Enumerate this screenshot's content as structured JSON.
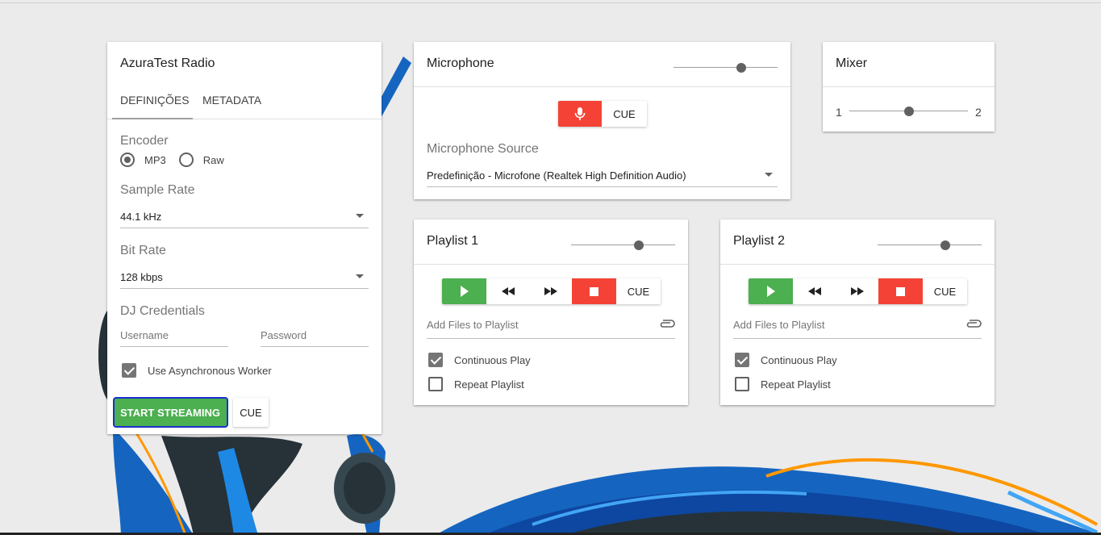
{
  "settings": {
    "title": "AzuraTest Radio",
    "tabs": [
      "DEFINIÇÕES",
      "METADATA"
    ],
    "encoder": {
      "label": "Encoder",
      "options": [
        "MP3",
        "Raw"
      ],
      "selected": "MP3"
    },
    "sample_rate": {
      "label": "Sample Rate",
      "value": "44.1 kHz"
    },
    "bit_rate": {
      "label": "Bit Rate",
      "value": "128 kbps"
    },
    "credentials": {
      "label": "DJ Credentials",
      "username_placeholder": "Username",
      "password_placeholder": "Password"
    },
    "async_worker": {
      "label": "Use Asynchronous Worker",
      "checked": true
    },
    "start_label": "START STREAMING",
    "cue_label": "CUE"
  },
  "microphone": {
    "title": "Microphone",
    "volume": 0.65,
    "cue_label": "CUE",
    "source_label": "Microphone Source",
    "source_value": "Predefinição - Microfone (Realtek High Definition Audio)"
  },
  "mixer": {
    "title": "Mixer",
    "left_label": "1",
    "right_label": "2",
    "position": 0.5
  },
  "playlists": [
    {
      "title": "Playlist 1",
      "volume": 0.65,
      "cue_label": "CUE",
      "add_files": "Add Files to Playlist",
      "continuous_play": {
        "label": "Continuous Play",
        "checked": true
      },
      "repeat_playlist": {
        "label": "Repeat Playlist",
        "checked": false
      }
    },
    {
      "title": "Playlist 2",
      "volume": 0.65,
      "cue_label": "CUE",
      "add_files": "Add Files to Playlist",
      "continuous_play": {
        "label": "Continuous Play",
        "checked": true
      },
      "repeat_playlist": {
        "label": "Repeat Playlist",
        "checked": false
      }
    }
  ],
  "colors": {
    "green": "#4caf50",
    "red": "#f44336",
    "background": "#ebebeb",
    "art_blue": "#1565c0",
    "art_orange": "#ff9800"
  }
}
